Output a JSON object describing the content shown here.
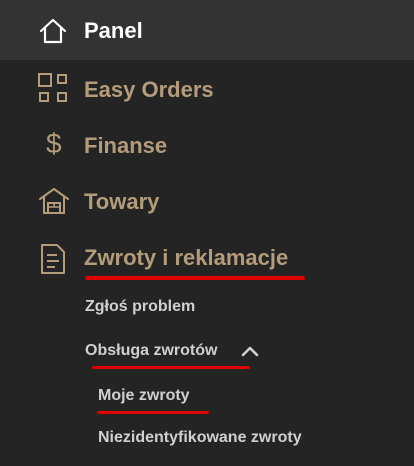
{
  "nav": {
    "items": [
      {
        "label": "Panel",
        "icon": "home-icon"
      },
      {
        "label": "Easy Orders",
        "icon": "grid-icon"
      },
      {
        "label": "Finanse",
        "icon": "dollar-icon"
      },
      {
        "label": "Towary",
        "icon": "warehouse-icon"
      },
      {
        "label": "Zwroty i reklamacje",
        "icon": "document-icon"
      }
    ],
    "sub": {
      "report_problem": "Zgłoś problem",
      "returns_handling": "Obsługa zwrotów",
      "my_returns": "Moje zwroty",
      "unidentified_returns": "Niezidentyfikowane zwroty"
    }
  },
  "colors": {
    "background": "#242424",
    "active_row": "#333333",
    "active_text": "#ffffff",
    "item_text": "#b39c7a",
    "sub_text": "#d0d0d0",
    "highlight": "#e00000"
  }
}
